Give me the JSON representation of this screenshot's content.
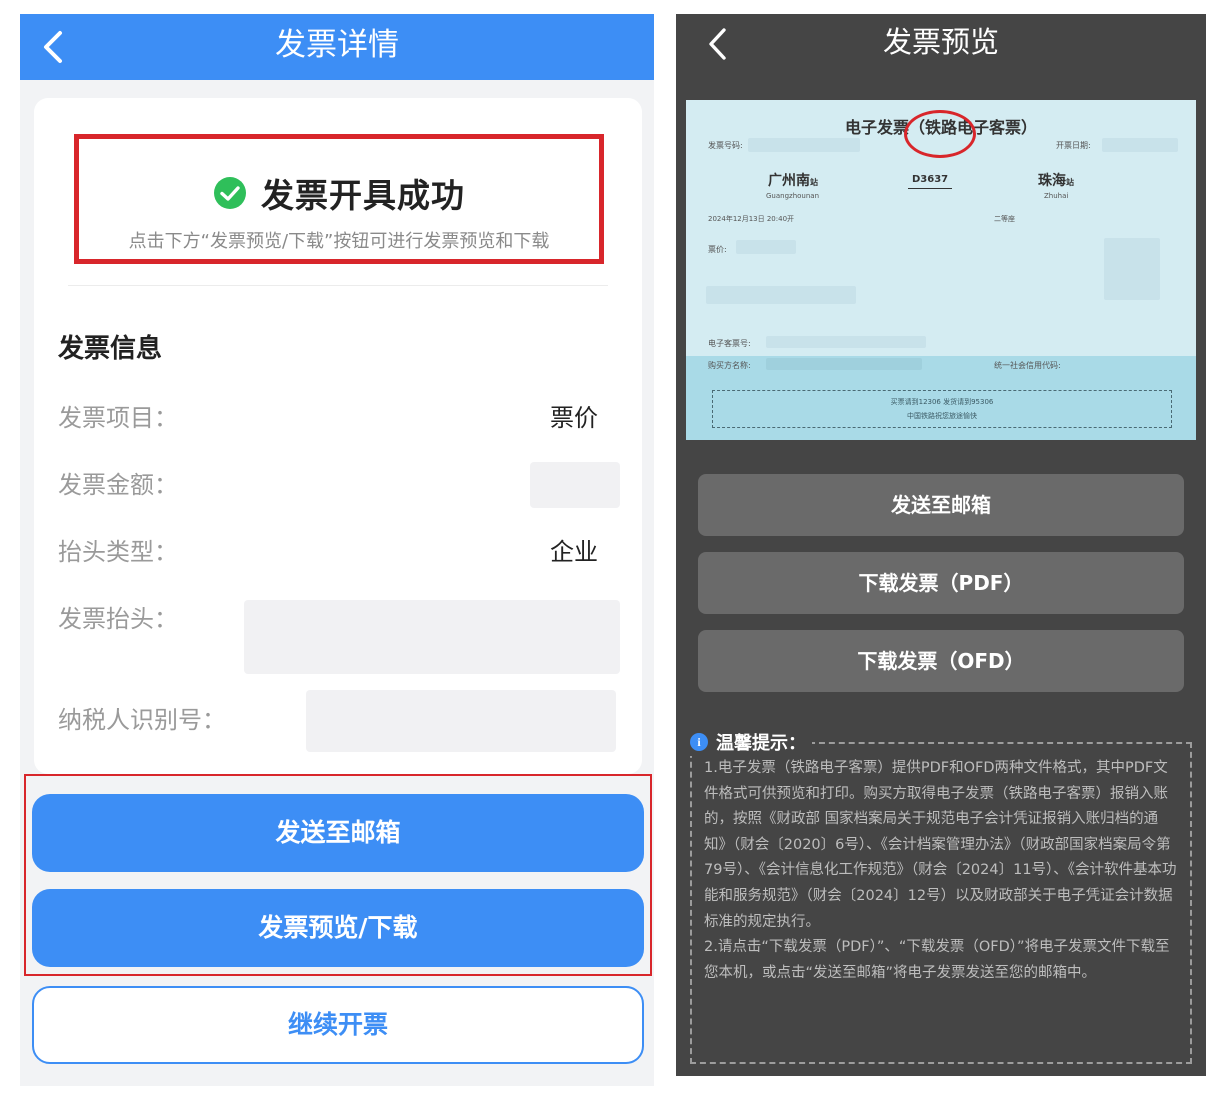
{
  "left_screen": {
    "header": {
      "title": "发票详情"
    },
    "success": {
      "title": "发票开具成功",
      "subtitle": "点击下方“发票预览/下载”按钮可进行发票预览和下载"
    },
    "info": {
      "section_title": "发票信息",
      "rows": [
        {
          "label": "发票项目：",
          "value": "票价"
        },
        {
          "label": "发票金额：",
          "value": ""
        },
        {
          "label": "抬头类型：",
          "value": "企业"
        },
        {
          "label": "发票抬头：",
          "value": ""
        },
        {
          "label": "纳税人识别号：",
          "value": ""
        }
      ]
    },
    "buttons": {
      "send_email": "发送至邮箱",
      "preview_download": "发票预览/下载",
      "continue": "继续开票"
    }
  },
  "right_screen": {
    "header": {
      "title": "发票预览"
    },
    "ticket": {
      "title": "电子发票（铁路电子客票）",
      "invoice_no_label": "发票号码:",
      "issue_date_label": "开票日期:",
      "from_station": "广州南",
      "from_station_suffix": "站",
      "from_pinyin": "Guangzhounan",
      "train_no": "D3637",
      "to_station": "珠海",
      "to_station_suffix": "站",
      "to_pinyin": "Zhuhai",
      "date_time": "2024年12月13日  20:40开",
      "seat_class": "二等座",
      "fare_label": "票价:",
      "eticket_label": "电子客票号:",
      "buyer_label": "购买方名称:",
      "credit_code_label": "统一社会信用代码:",
      "footer_line1": "买票请到12306 发货请到95306",
      "footer_line2": "中国铁路祝您旅途愉快"
    },
    "buttons": {
      "send_email": "发送至邮箱",
      "download_pdf": "下载发票（PDF）",
      "download_ofd": "下载发票（OFD）"
    },
    "tips": {
      "title": "温馨提示：",
      "p1": "1.电子发票（铁路电子客票）提供PDF和OFD两种文件格式，其中PDF文件格式可供预览和打印。购买方取得电子发票（铁路电子客票）报销入账的，按照《财政部 国家档案局关于规范电子会计凭证报销入账归档的通知》（财会〔2020〕6号）、《会计档案管理办法》（财政部国家档案局令第79号）、《会计信息化工作规范》（财会〔2024〕11号）、《会计软件基本功能和服务规范》（财会〔2024〕12号）以及财政部关于电子凭证会计数据标准的规定执行。",
      "p2": "2.请点击“下载发票（PDF）”、“下载发票（OFD）”将电子发票文件下载至您本机，或点击“发送至邮箱”将电子发票发送至您的邮箱中。"
    }
  },
  "colors": {
    "primary_blue": "#3d8ef5",
    "highlight_red": "#d8262b",
    "success_green": "#2fbf5a",
    "dark_bg": "#454545",
    "dark_button": "#6a6a6a"
  },
  "icons": {
    "back": "chevron-left-icon",
    "success": "check-circle-icon",
    "tips": "info-icon"
  }
}
